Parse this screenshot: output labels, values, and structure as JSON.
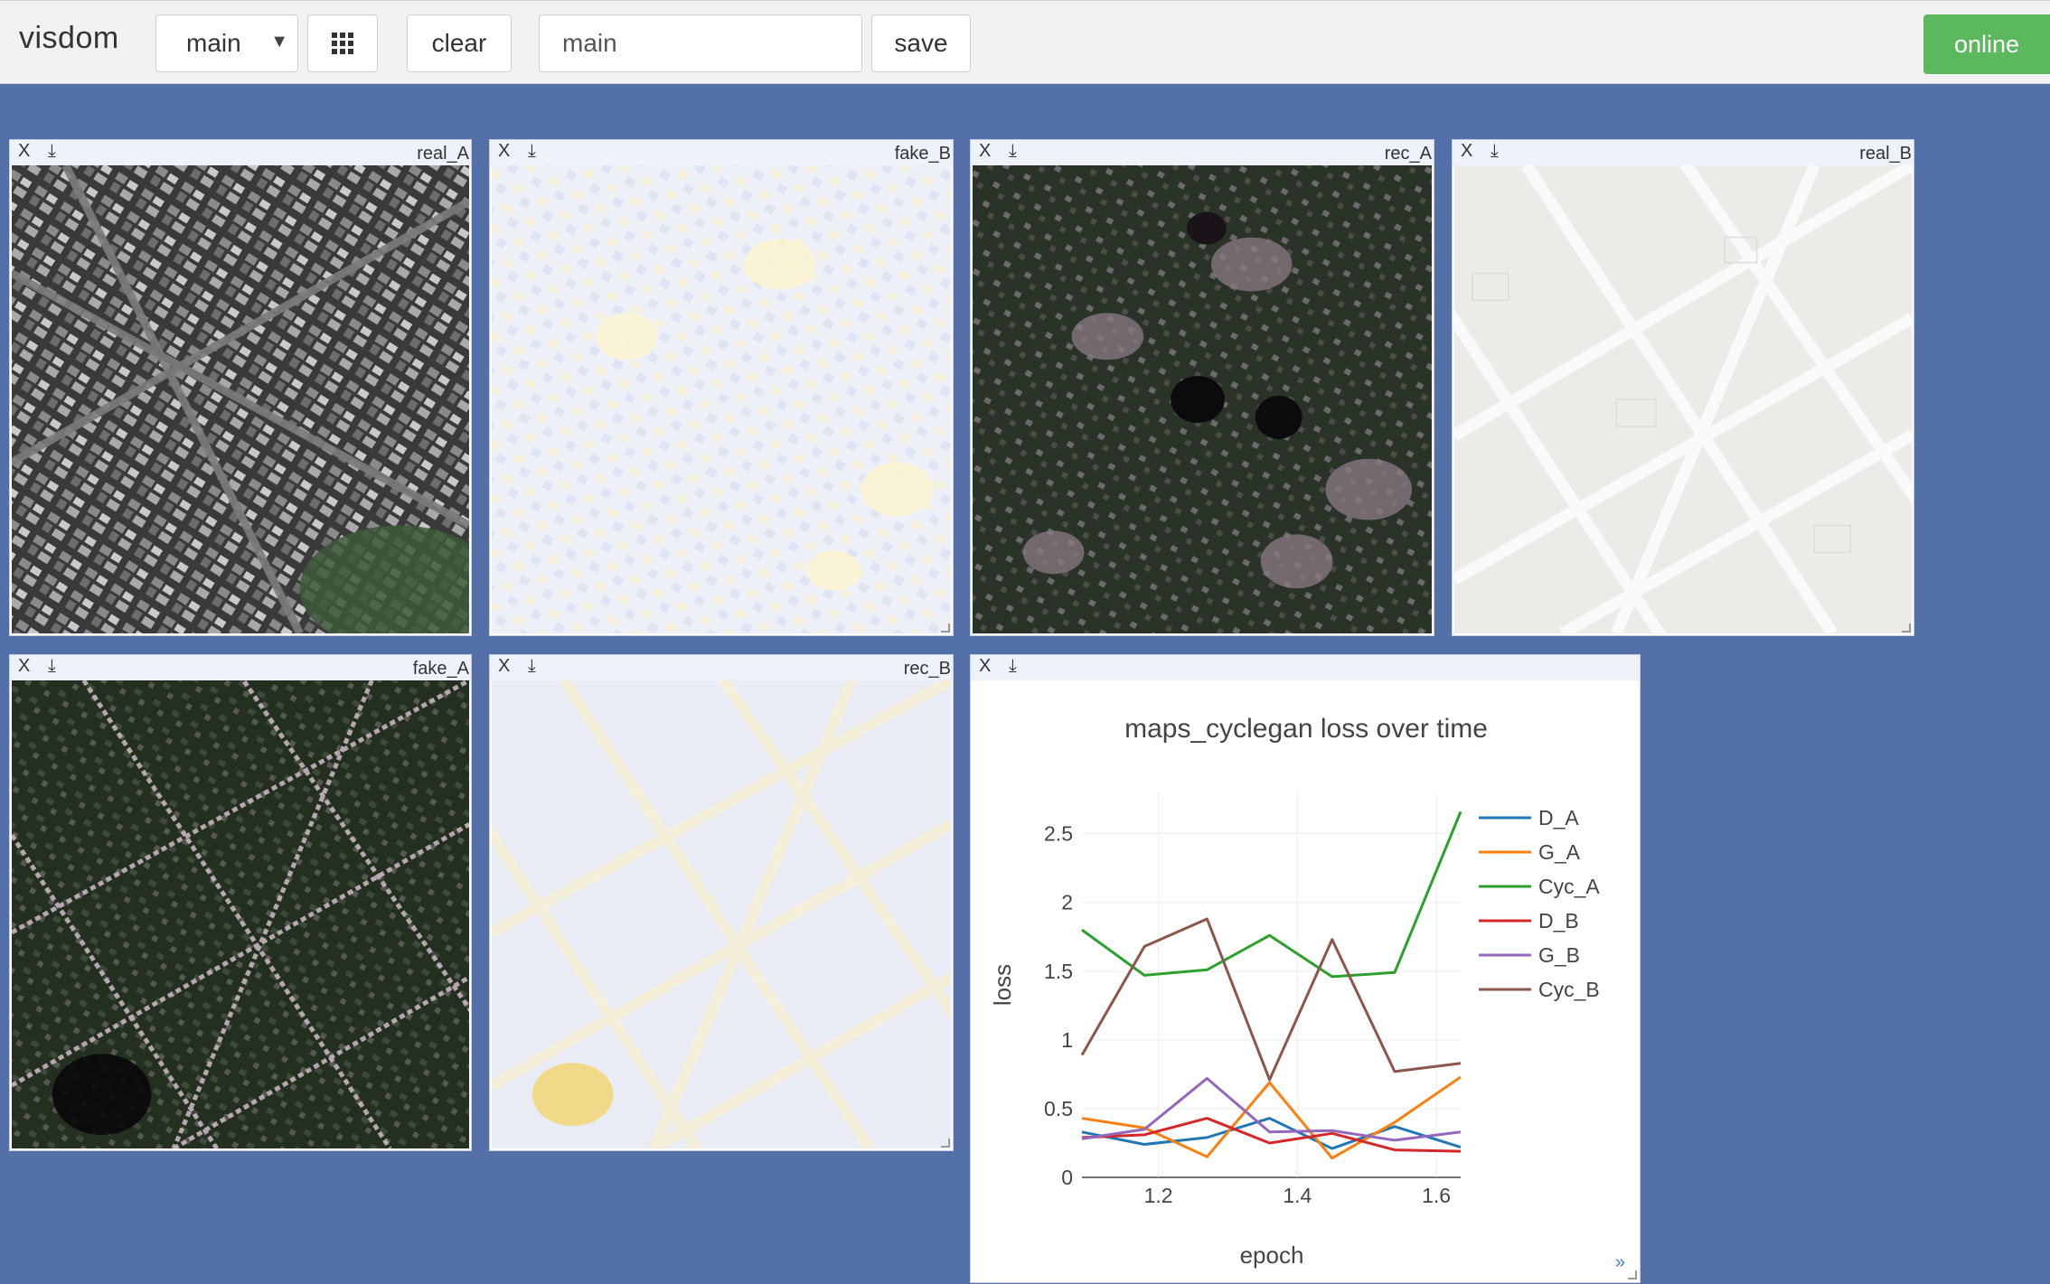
{
  "toolbar": {
    "brand": "visdom",
    "env_select": "main",
    "clear_label": "clear",
    "env_input_value": "main",
    "save_label": "save",
    "status": "online",
    "status_color": "#5cb85c"
  },
  "panes": [
    {
      "title": "real_A",
      "close": "X",
      "download": "⤓",
      "image": "aerial photo (satellite view of city blocks)"
    },
    {
      "title": "fake_B",
      "close": "X",
      "download": "⤓",
      "image": "generated map (pale yellow/blue blurry street blocks)"
    },
    {
      "title": "rec_A",
      "close": "X",
      "download": "⤓",
      "image": "reconstructed aerial photo (dark green with blotches)"
    },
    {
      "title": "real_B",
      "close": "X",
      "download": "⤓",
      "image": "street map (light gray with white diagonal roads)"
    },
    {
      "title": "fake_A",
      "close": "X",
      "download": "⤓",
      "image": "generated aerial photo (dark with diagonal streets)"
    },
    {
      "title": "rec_B",
      "close": "X",
      "download": "⤓",
      "image": "reconstructed map (pale blurry diagonal streets)"
    }
  ],
  "plot_pane": {
    "close": "X",
    "download": "⤓",
    "more": "»"
  },
  "chart_data": {
    "type": "line",
    "title": "maps_cyclegan loss over time",
    "xlabel": "epoch",
    "ylabel": "loss",
    "xlim": [
      1.09,
      1.635
    ],
    "ylim": [
      0,
      2.8
    ],
    "xticks": [
      "1.2",
      "1.4",
      "1.6"
    ],
    "yticks": [
      "0",
      "0.5",
      "1",
      "1.5",
      "2",
      "2.5"
    ],
    "grid": true,
    "legend_position": "right",
    "x": [
      1.09,
      1.18,
      1.27,
      1.36,
      1.45,
      1.54,
      1.635
    ],
    "series": [
      {
        "name": "D_A",
        "color": "#1f77b4",
        "values": [
          0.33,
          0.24,
          0.29,
          0.43,
          0.21,
          0.37,
          0.22
        ]
      },
      {
        "name": "G_A",
        "color": "#ff7f0e",
        "values": [
          0.43,
          0.36,
          0.15,
          0.69,
          0.14,
          0.4,
          0.73
        ]
      },
      {
        "name": "Cyc_A",
        "color": "#2ca02c",
        "values": [
          1.8,
          1.47,
          1.51,
          1.76,
          1.46,
          1.49,
          2.66
        ]
      },
      {
        "name": "D_B",
        "color": "#d62728",
        "values": [
          0.29,
          0.31,
          0.43,
          0.25,
          0.32,
          0.2,
          0.19
        ]
      },
      {
        "name": "G_B",
        "color": "#9467bd",
        "values": [
          0.28,
          0.35,
          0.72,
          0.33,
          0.34,
          0.27,
          0.33
        ]
      },
      {
        "name": "Cyc_B",
        "color": "#8c564b",
        "values": [
          0.89,
          1.68,
          1.88,
          0.71,
          1.73,
          0.77,
          0.83
        ]
      }
    ]
  }
}
